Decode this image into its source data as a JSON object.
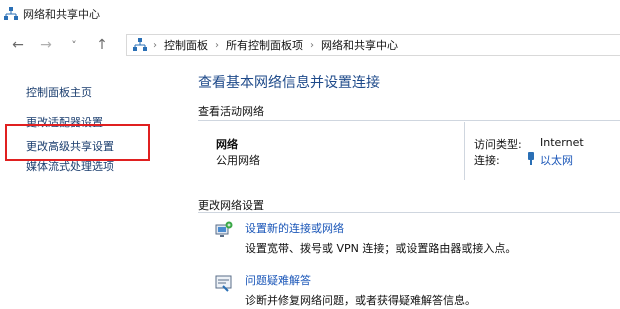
{
  "window": {
    "title": "网络和共享中心"
  },
  "nav": {
    "back": "←",
    "forward": "→",
    "recent": "˅",
    "up": "↑",
    "breadcrumb": [
      "控制面板",
      "所有控制面板项",
      "网络和共享中心"
    ],
    "separator": "›"
  },
  "sidebar": {
    "items": [
      {
        "label": "控制面板主页"
      },
      {
        "label": "更改适配器设置"
      },
      {
        "label": "更改高级共享设置"
      },
      {
        "label": "媒体流式处理选项"
      }
    ]
  },
  "main": {
    "heading": "查看基本网络信息并设置连接",
    "active_section": "查看活动网络",
    "network": {
      "name": "网络",
      "type": "公用网络",
      "access_label": "访问类型:",
      "access_value": "Internet",
      "conn_label": "连接:",
      "conn_value": "以太网"
    },
    "change_section": "更改网络设置",
    "tasks": [
      {
        "title": "设置新的连接或网络",
        "desc": "设置宽带、拨号或 VPN 连接；或设置路由器或接入点。"
      },
      {
        "title": "问题疑难解答",
        "desc": "诊断并修复网络问题，或者获得疑难解答信息。"
      }
    ]
  },
  "colors": {
    "link": "#1a56b8",
    "heading": "#1e4a8a",
    "highlight_box": "#e02020"
  }
}
